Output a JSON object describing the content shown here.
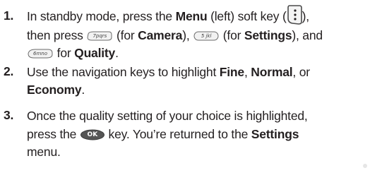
{
  "steps": [
    {
      "number": "1.",
      "line1": {
        "t1": "In standby mode, press the ",
        "b1": "Menu",
        "t2": " (left) soft key (",
        "t3": "),"
      },
      "line2": {
        "t1": "then press ",
        "t2": " (for ",
        "b1": "Camera",
        "t3": "), ",
        "t4": " (for ",
        "b2": "Settings",
        "t5": "), and"
      },
      "line3": {
        "t1": " for ",
        "b1": "Quality",
        "t2": "."
      },
      "keys": {
        "soft_key_icon": "left-soft-key-icon",
        "camera_key_label": "7pqrs",
        "settings_key_label": "5 jkl",
        "quality_key_label": "6mno"
      }
    },
    {
      "number": "2.",
      "line1": {
        "t1": "Use the navigation keys to highlight ",
        "b1": "Fine",
        "t2": ", ",
        "b2": "Normal",
        "t3": ", or"
      },
      "line2": {
        "b1": "Economy",
        "t1": "."
      }
    },
    {
      "number": "3.",
      "line1": {
        "t1": "Once the quality setting of your choice is highlighted,"
      },
      "line2": {
        "t1": "press the ",
        "t2": " key. You’re returned to the ",
        "b1": "Settings"
      },
      "line3": {
        "t1": "menu."
      },
      "keys": {
        "ok_key_label": "OK"
      }
    }
  ],
  "colors": {
    "text": "#231f20",
    "key_fill": "#f2f2f2",
    "key_stroke": "#6b6b6b",
    "ok_key_fill": "#555555"
  }
}
